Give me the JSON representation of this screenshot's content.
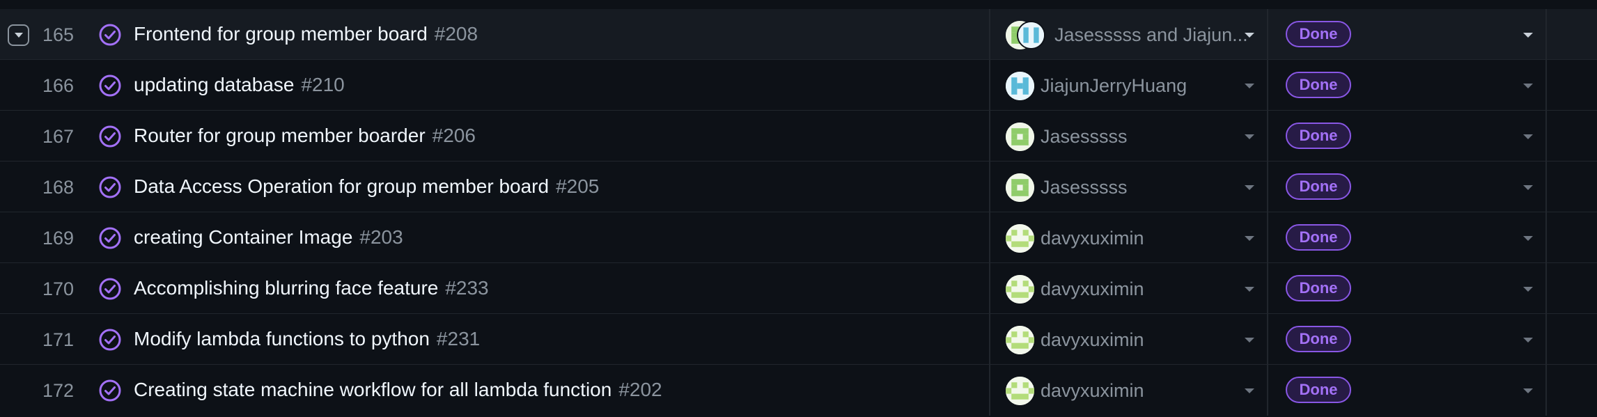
{
  "colors": {
    "background": "#0d1117",
    "accent_purple": "#a371f7",
    "text_muted": "#8b949e"
  },
  "rows": [
    {
      "num": "165",
      "title": "Frontend for group member board",
      "issue": "#208",
      "assignee": "Jasesssss and Jiajun...",
      "status": "Done",
      "expandable": true
    },
    {
      "num": "166",
      "title": "updating database",
      "issue": "#210",
      "assignee": "JiajunJerryHuang",
      "status": "Done"
    },
    {
      "num": "167",
      "title": "Router for group member boarder",
      "issue": "#206",
      "assignee": "Jasesssss",
      "status": "Done"
    },
    {
      "num": "168",
      "title": "Data Access Operation for group member board",
      "issue": "#205",
      "assignee": "Jasesssss",
      "status": "Done"
    },
    {
      "num": "169",
      "title": "creating Container Image",
      "issue": "#203",
      "assignee": "davyxuximin",
      "status": "Done"
    },
    {
      "num": "170",
      "title": "Accomplishing blurring face feature",
      "issue": "#233",
      "assignee": "davyxuximin",
      "status": "Done"
    },
    {
      "num": "171",
      "title": "Modify lambda functions to python",
      "issue": "#231",
      "assignee": "davyxuximin",
      "status": "Done"
    },
    {
      "num": "172",
      "title": "Creating state machine workflow for all lambda function",
      "issue": "#202",
      "assignee": "davyxuximin",
      "status": "Done"
    }
  ]
}
